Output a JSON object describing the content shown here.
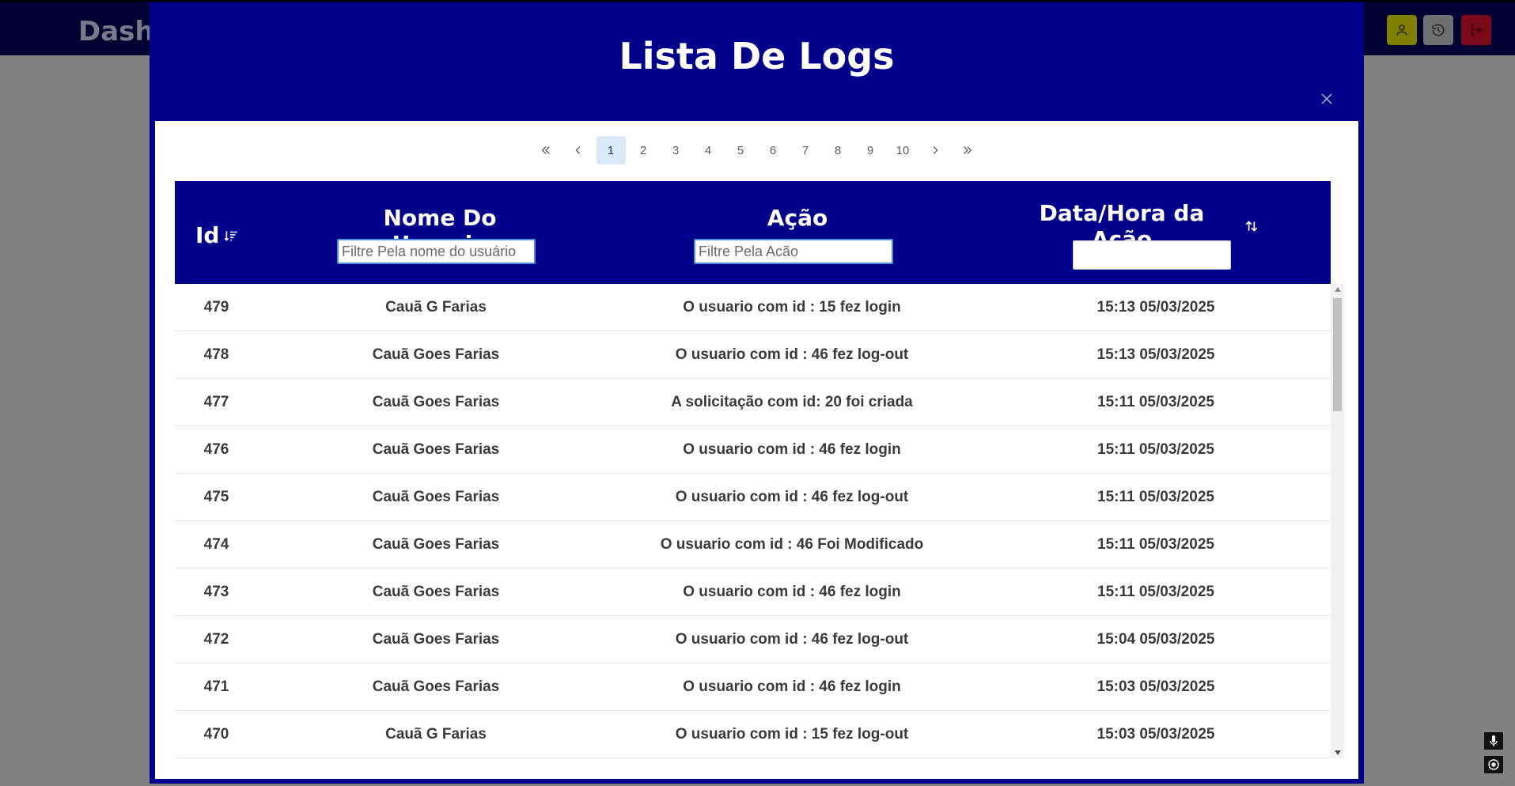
{
  "app": {
    "title": "DashB"
  },
  "modal": {
    "title": "Lista De Logs"
  },
  "pagination": {
    "pages": [
      "1",
      "2",
      "3",
      "4",
      "5",
      "6",
      "7",
      "8",
      "9",
      "10"
    ],
    "current": "1"
  },
  "table": {
    "headers": {
      "id": "Id",
      "name": "Nome Do Usuario",
      "acao": "Ação",
      "data": "Data/Hora da Ação"
    },
    "filters": {
      "name_placeholder": "Filtre Pela nome do usuário",
      "acao_placeholder": "Filtre Pela Acão",
      "data_value": ""
    },
    "rows": [
      {
        "id": "479",
        "name": "Cauã G Farias",
        "acao": "O usuario com id : 15 fez login",
        "data": "15:13 05/03/2025"
      },
      {
        "id": "478",
        "name": "Cauã Goes Farias",
        "acao": "O usuario com id : 46 fez log-out",
        "data": "15:13 05/03/2025"
      },
      {
        "id": "477",
        "name": "Cauã Goes Farias",
        "acao": "A solicitação com id: 20 foi criada",
        "data": "15:11 05/03/2025"
      },
      {
        "id": "476",
        "name": "Cauã Goes Farias",
        "acao": "O usuario com id : 46 fez login",
        "data": "15:11 05/03/2025"
      },
      {
        "id": "475",
        "name": "Cauã Goes Farias",
        "acao": "O usuario com id : 46 fez log-out",
        "data": "15:11 05/03/2025"
      },
      {
        "id": "474",
        "name": "Cauã Goes Farias",
        "acao": "O usuario com id : 46 Foi Modificado",
        "data": "15:11 05/03/2025"
      },
      {
        "id": "473",
        "name": "Cauã Goes Farias",
        "acao": "O usuario com id : 46 fez login",
        "data": "15:11 05/03/2025"
      },
      {
        "id": "472",
        "name": "Cauã Goes Farias",
        "acao": "O usuario com id : 46 fez log-out",
        "data": "15:04 05/03/2025"
      },
      {
        "id": "471",
        "name": "Cauã Goes Farias",
        "acao": "O usuario com id : 46 fez login",
        "data": "15:03 05/03/2025"
      },
      {
        "id": "470",
        "name": "Cauã G Farias",
        "acao": "O usuario com id : 15 fez log-out",
        "data": "15:03 05/03/2025"
      }
    ]
  },
  "colors": {
    "primary": "#00008b",
    "active_page": "#dbe9f7"
  },
  "icons": {
    "header": [
      "user-icon",
      "history-icon",
      "logout-icon"
    ],
    "corner": [
      "microphone-icon",
      "target-icon"
    ]
  }
}
